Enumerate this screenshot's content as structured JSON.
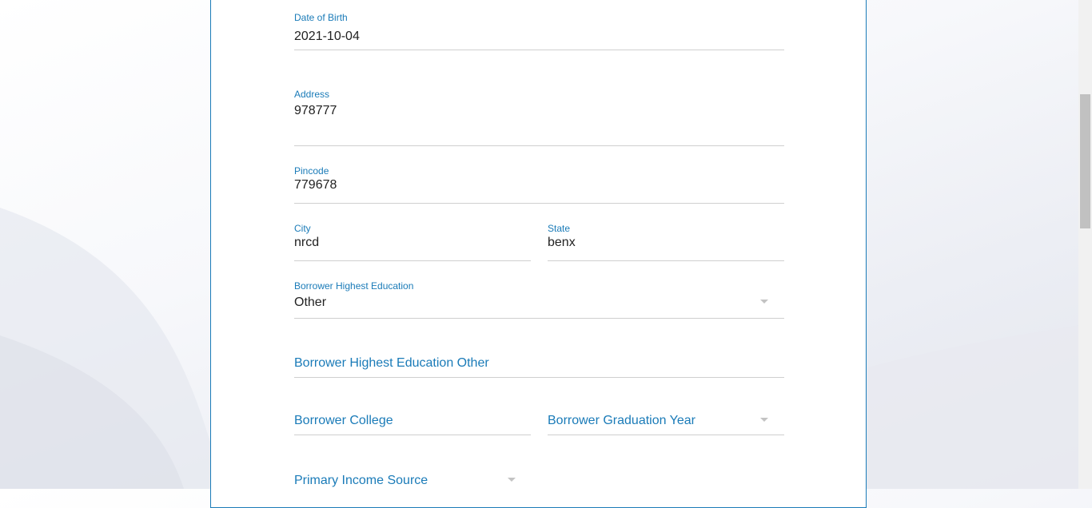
{
  "form": {
    "date_of_birth": {
      "label": "Date of Birth",
      "value": "2021-10-04"
    },
    "address": {
      "label": "Address",
      "value": "978777"
    },
    "pincode": {
      "label": "Pincode",
      "value": "779678"
    },
    "city": {
      "label": "City",
      "value": "nrcd"
    },
    "state": {
      "label": "State",
      "value": "benx"
    },
    "highest_education": {
      "label": "Borrower Highest Education",
      "value": "Other"
    },
    "highest_education_other": {
      "placeholder": "Borrower Highest Education Other"
    },
    "college": {
      "placeholder": "Borrower College"
    },
    "graduation_year": {
      "placeholder": "Borrower Graduation Year"
    },
    "primary_income_source": {
      "placeholder": "Primary Income Source"
    }
  },
  "icons": {
    "dropdown": "chevron-down-icon"
  },
  "colors": {
    "accent": "#1a7bb8",
    "underline": "#cfcfcf",
    "text": "#222222"
  }
}
